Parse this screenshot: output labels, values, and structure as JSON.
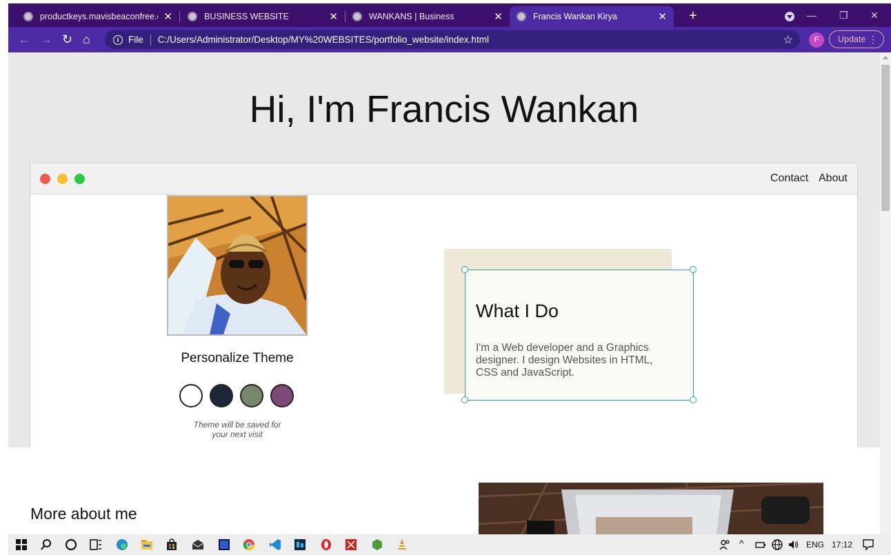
{
  "browser": {
    "tabs": [
      {
        "title": "productkeys.mavisbeaconfree.co",
        "active": false
      },
      {
        "title": "BUSINESS WEBSITE",
        "active": false
      },
      {
        "title": "WANKANS | Business",
        "active": false
      },
      {
        "title": "Francis Wankan Kirya",
        "active": true
      }
    ],
    "new_tab": "+",
    "address": {
      "scheme_label": "File",
      "url": "C:/Users/Administrator/Desktop/MY%20WEBSITES/portfolio_website/index.html"
    },
    "profile_initial": "F",
    "update_label": "Update"
  },
  "page": {
    "heading": "Hi, I'm Francis Wankan",
    "nav": {
      "contact": "Contact",
      "about": "About"
    },
    "theme": {
      "title": "Personalize Theme",
      "swatches": [
        "#ffffff",
        "#1c2837",
        "#76866a",
        "#7d4a77"
      ],
      "note_line1": "Theme will be saved for",
      "note_line2": "your next visit"
    },
    "card": {
      "title": "What I Do",
      "text": "I'm a Web developer and a Graphics designer. I design Websites in HTML, CSS and JavaScript."
    },
    "more_title": "More about me"
  },
  "taskbar": {
    "lang": "ENG",
    "time": "17:12"
  }
}
